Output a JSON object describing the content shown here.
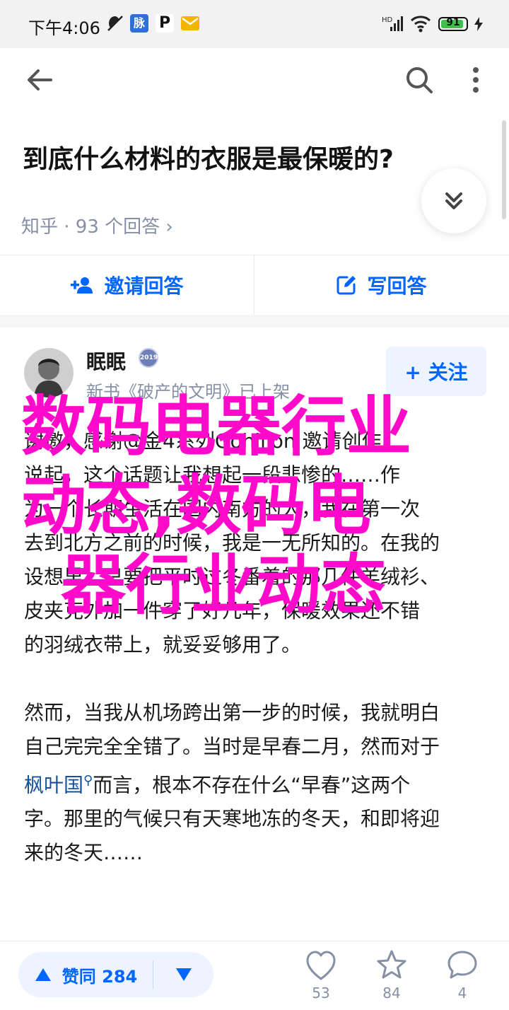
{
  "status_bar": {
    "time": "下午4:06",
    "badge_pulse": "脉",
    "badge_p": "P",
    "battery": "91",
    "battery_level": 0.91
  },
  "nav": {
    "back_icon": "arrow-left-icon",
    "search_icon": "search-icon",
    "more_icon": "more-vertical-icon"
  },
  "question": {
    "title": "到底什么材料的衣服是最保暖的?",
    "meta": "知乎 · 93 个回答 ›"
  },
  "actions": {
    "invite_label": "邀请回答",
    "write_label": "写回答"
  },
  "author": {
    "name": "眠眠",
    "badge": "2019",
    "bio": "新书《破产的文明》已上架",
    "follow_label": "+ 关注"
  },
  "answer": {
    "paragraph_1": [
      "谢邀，感谢@金4系列Gohilion 邀请创作",
      "说起，这个话题让我想起一段悲惨的……作",
      "为一个长期生活在国内南方的人，我在第一次",
      "去到北方之前的时候，我是一无所知的。在我的",
      "设想里，只要把平时过冬番着的那几件羊绒衫、",
      "皮夹克外加一件穿了好几年，保暖效果还不错",
      "的羽绒衣带上，就妥妥够用了。"
    ],
    "paragraph_2": [
      "然而，当我从机场跨出第一步的时候，我就明白",
      "自己完完全全错了。当时是早春二月，然而对于"
    ],
    "link_text": "枫叶国",
    "link_suffix": "而言，根本不存在什么“早春”这两个",
    "paragraph_2_rest": [
      "字。那里的气候只有天寒地冻的冬天，和即将迎",
      "来的冬天……"
    ]
  },
  "overlay": {
    "lines": [
      "数码电器行业",
      "动态,数码电",
      "器行业动态"
    ]
  },
  "bottom_bar": {
    "upvote_label": "赞同 284",
    "like_count": "53",
    "star_count": "84",
    "comment_count": "4"
  },
  "colors": {
    "accent": "#0066ff",
    "overlay": "#ff0acb",
    "muted": "#8590a6"
  }
}
